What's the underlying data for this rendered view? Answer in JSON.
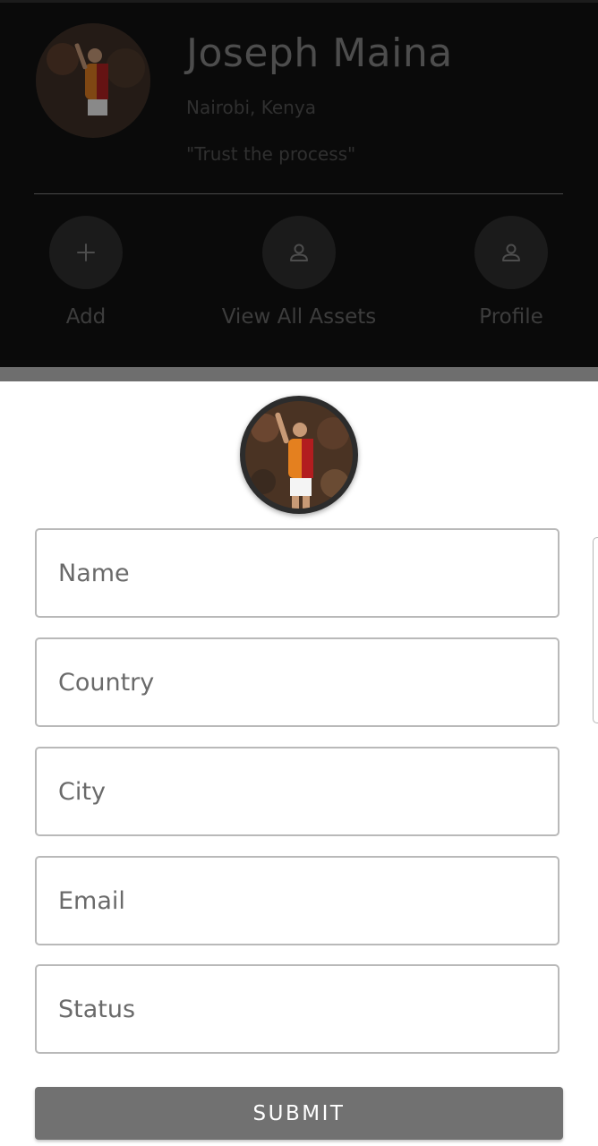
{
  "profile": {
    "name": "Joseph Maina",
    "location": "Nairobi, Kenya",
    "quote": "\"Trust the process\""
  },
  "actions": [
    {
      "label": "Add",
      "icon": "plus-icon"
    },
    {
      "label": "View All Assets",
      "icon": "person-icon"
    },
    {
      "label": "Profile",
      "icon": "person-icon"
    }
  ],
  "form": {
    "fields": {
      "name": {
        "placeholder": "Name",
        "value": ""
      },
      "country": {
        "placeholder": "Country",
        "value": ""
      },
      "city": {
        "placeholder": "City",
        "value": ""
      },
      "email": {
        "placeholder": "Email",
        "value": ""
      },
      "status": {
        "placeholder": "Status",
        "value": ""
      }
    },
    "submit_label": "SUBMIT"
  },
  "colors": {
    "header_bg": "#0a0a0a",
    "submit_bg": "#717171",
    "field_border": "#b9b9b9"
  }
}
